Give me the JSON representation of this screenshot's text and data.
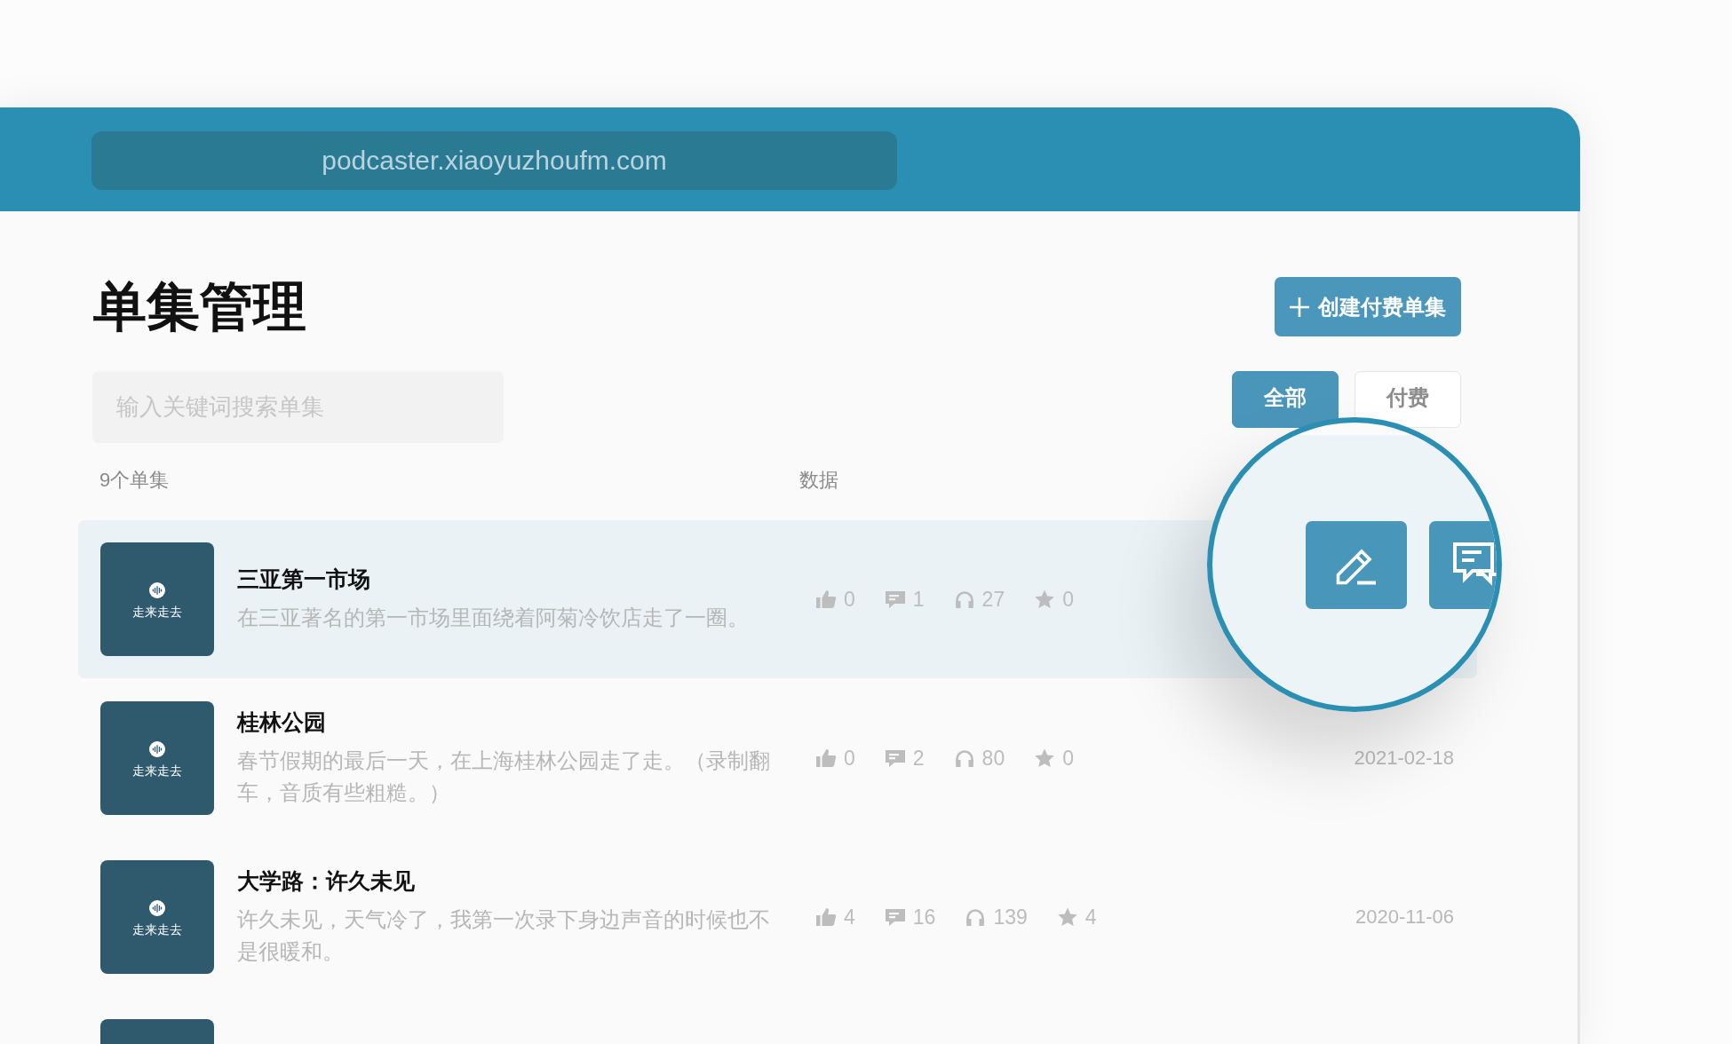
{
  "browser": {
    "url": "podcaster.xiaoyuzhoufm.com"
  },
  "page": {
    "title": "单集管理",
    "create_button": {
      "label": "创建付费单集"
    },
    "search": {
      "placeholder": "输入关键词搜索单集"
    },
    "filters": [
      {
        "label": "全部",
        "selected": true
      },
      {
        "label": "付费",
        "selected": false
      }
    ]
  },
  "list_header": {
    "episode_count": "9个单集",
    "stats_heading": "数据"
  },
  "episodes": [
    {
      "highlighted": true,
      "cover_text": "走来走去",
      "title": "三亚第一市场",
      "description": "在三亚著名的第一市场里面绕着阿菊冷饮店走了一圈。",
      "stats": [
        {
          "kind": "likes",
          "value": "0"
        },
        {
          "kind": "comments",
          "value": "1"
        },
        {
          "kind": "listens",
          "value": "27"
        },
        {
          "kind": "favorites",
          "value": "0"
        }
      ]
    },
    {
      "highlighted": false,
      "cover_text": "走来走去",
      "title": "桂林公园",
      "description": "春节假期的最后一天，在上海桂林公园走了走。（录制翻车，音质有些粗糙。）",
      "stats": [
        {
          "kind": "likes",
          "value": "0"
        },
        {
          "kind": "comments",
          "value": "2"
        },
        {
          "kind": "listens",
          "value": "80"
        },
        {
          "kind": "favorites",
          "value": "0"
        }
      ],
      "date": "2021-02-18"
    },
    {
      "highlighted": false,
      "cover_text": "走来走去",
      "title": "大学路：许久未见",
      "description": "许久未见，天气冷了，我第一次录下身边声音的时候也不是很暖和。",
      "stats": [
        {
          "kind": "likes",
          "value": "4"
        },
        {
          "kind": "comments",
          "value": "16"
        },
        {
          "kind": "listens",
          "value": "139"
        },
        {
          "kind": "favorites",
          "value": "4"
        }
      ],
      "date": "2020-11-06"
    },
    {
      "highlighted": false
    }
  ],
  "magnifier": {
    "actions": [
      {
        "kind": "edit"
      },
      {
        "kind": "comments"
      }
    ]
  }
}
